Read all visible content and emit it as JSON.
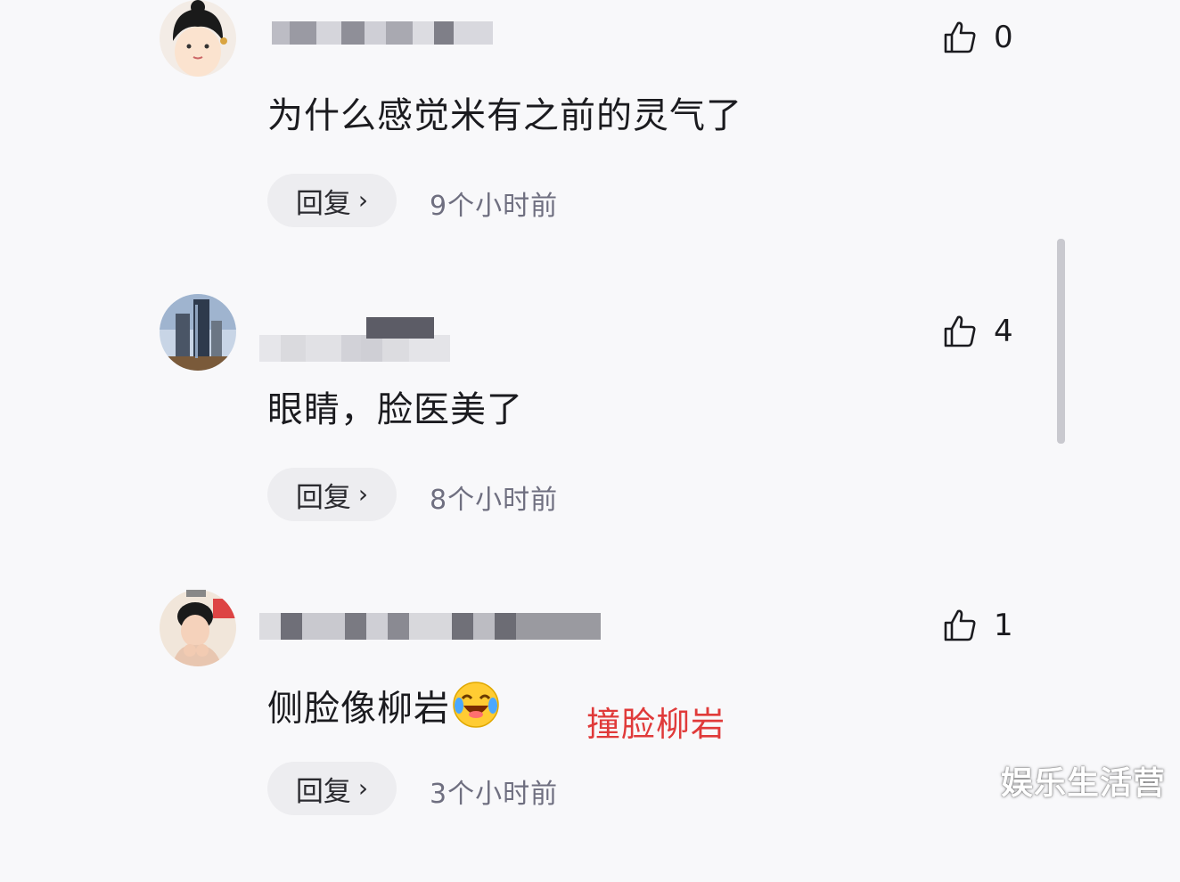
{
  "comments": [
    {
      "text": "为什么感觉米有之前的灵气了",
      "reply_label": "回复",
      "timestamp": "9个小时前",
      "like_count": "0"
    },
    {
      "text": "眼睛，脸医美了",
      "reply_label": "回复",
      "timestamp": "8个小时前",
      "like_count": "4"
    },
    {
      "text": "侧脸像柳岩",
      "emoji": "laughing-crying-emoji",
      "reply_label": "回复",
      "timestamp": "3个小时前",
      "like_count": "1"
    }
  ],
  "annotation": "撞脸柳岩",
  "watermark": "娱乐生活营",
  "icons": {
    "like": "thumbs-up-icon",
    "reply_arrow": "chevron-right-icon"
  },
  "colors": {
    "background": "#f8f8fa",
    "annotation": "#e03a3a",
    "timestamp": "#6f6f80",
    "reply_bg": "#ededf0"
  }
}
